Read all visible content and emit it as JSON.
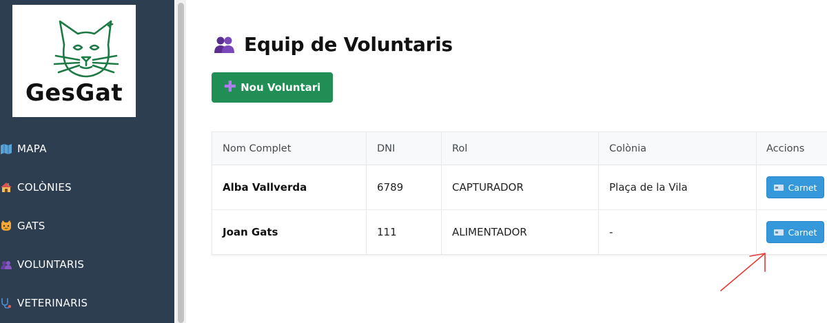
{
  "sidebar": {
    "logo_text": "GesGat",
    "items": [
      {
        "label": "MAPA",
        "icon": "map-icon"
      },
      {
        "label": "COLÒNIES",
        "icon": "house-icon"
      },
      {
        "label": "GATS",
        "icon": "cat-face-icon"
      },
      {
        "label": "VOLUNTARIS",
        "icon": "people-icon"
      },
      {
        "label": "VETERINARIS",
        "icon": "stethoscope-icon"
      }
    ]
  },
  "main": {
    "title": "Equip de Voluntaris",
    "title_icon": "people-icon",
    "new_button_label": "Nou Voluntari",
    "table": {
      "headers": [
        "Nom Complet",
        "DNI",
        "Rol",
        "Colònia",
        "Accions"
      ],
      "rows": [
        {
          "name": "Alba Vallverda",
          "dni": "6789",
          "role": "CAPTURADOR",
          "colony": "Plaça de la Vila",
          "action": "Carnet"
        },
        {
          "name": "Joan Gats",
          "dni": "111",
          "role": "ALIMENTADOR",
          "colony": "-",
          "action": "Carnet"
        }
      ]
    }
  },
  "colors": {
    "sidebar_bg": "#2c3e50",
    "primary_green": "#218e55",
    "carnet_blue": "#3498db",
    "logo_green": "#1e7a45",
    "annotation_red": "#e53935"
  }
}
